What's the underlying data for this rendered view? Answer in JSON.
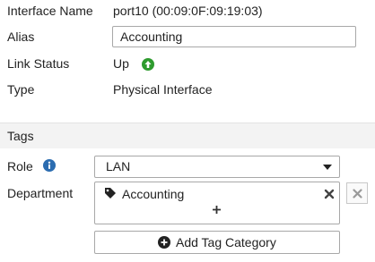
{
  "interface": {
    "label": "Interface Name",
    "value": "port10 (00:09:0F:09:19:03)"
  },
  "alias": {
    "label": "Alias",
    "value": "Accounting"
  },
  "link_status": {
    "label": "Link Status",
    "value": "Up",
    "icon": "arrow-up-circle-icon",
    "color": "#2e9b2e"
  },
  "type": {
    "label": "Type",
    "value": "Physical Interface"
  },
  "tags_section": {
    "title": "Tags"
  },
  "role": {
    "label": "Role",
    "selected": "LAN",
    "info_icon": "info-circle-icon",
    "info_color": "#2b6cb0"
  },
  "department": {
    "label": "Department",
    "tags": [
      {
        "name": "Accounting",
        "icon": "tag-icon"
      }
    ]
  },
  "add_tag_category": {
    "label": "Add Tag Category",
    "icon": "plus-circle-icon"
  }
}
